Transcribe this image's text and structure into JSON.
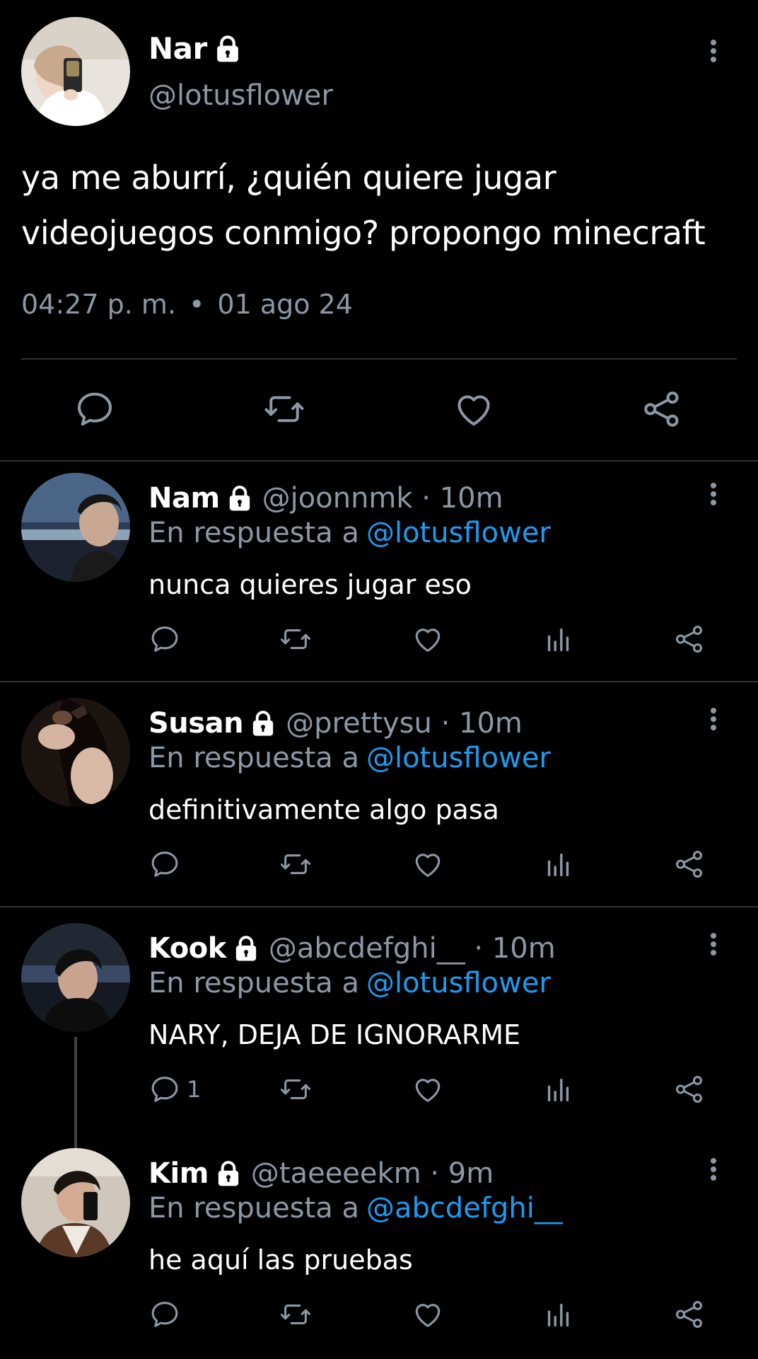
{
  "main_tweet": {
    "name": "Nar",
    "handle": "@lotusflower",
    "text_line1": "ya me aburrí, ¿quién quiere jugar",
    "text_line2": "videojuegos conmigo? propongo minecraft",
    "time": "04:27 p. m.",
    "separator": "•",
    "date": "01 ago 24"
  },
  "replies": [
    {
      "name": "Nam",
      "handle": "@joonnmk · 10m",
      "reply_to_label": "En respuesta a",
      "reply_to_mention": "@lotusflower",
      "text": "nunca quieres jugar eso",
      "reply_count": ""
    },
    {
      "name": "Susan",
      "handle": "@prettysu · 10m",
      "reply_to_label": "En respuesta a",
      "reply_to_mention": "@lotusflower",
      "text": "definitivamente algo pasa",
      "reply_count": ""
    },
    {
      "name": "Kook",
      "handle": "@abcdefghi__ · 10m",
      "reply_to_label": "En respuesta a",
      "reply_to_mention": "@lotusflower",
      "text": "NARY, DEJA DE IGNORARME",
      "reply_count": "1"
    },
    {
      "name": "Kim",
      "handle": "@taeeeekm · 9m",
      "reply_to_label": "En respuesta a",
      "reply_to_mention": "@abcdefghi__",
      "text": "he aquí las pruebas",
      "reply_count": ""
    }
  ],
  "icons": {
    "reply": "speech-bubble-icon",
    "retweet": "retweet-icon",
    "like": "heart-icon",
    "views": "bar-chart-icon",
    "share": "share-icon",
    "lock": "lock-icon",
    "more": "more-vertical-icon"
  },
  "colors": {
    "background": "#000000",
    "text": "#ffffff",
    "secondary": "#8b98a5",
    "link": "#1d9bf0",
    "divider": "#2f3336"
  }
}
